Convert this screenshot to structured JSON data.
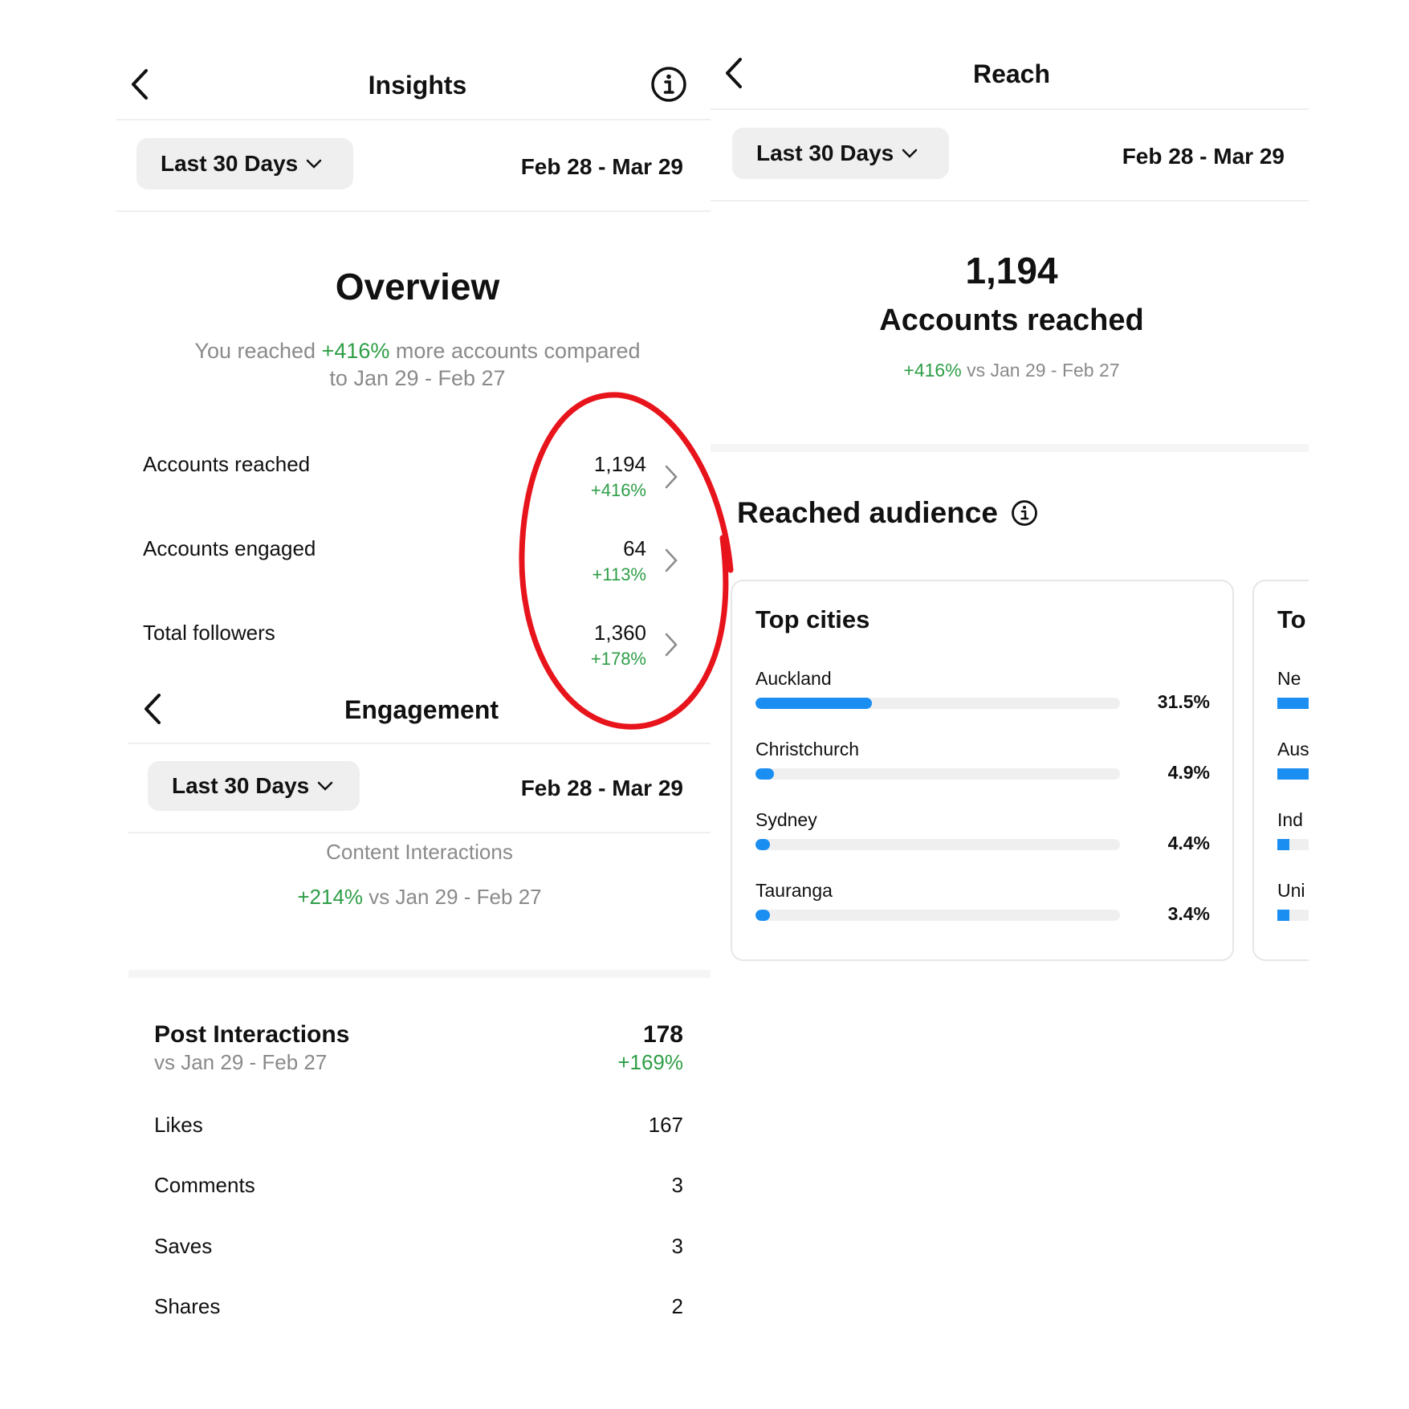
{
  "insights": {
    "title": "Insights",
    "range_label": "Last 30 Days",
    "date_range": "Feb 28 - Mar 29",
    "overview_title": "Overview",
    "summary_prefix": "You reached",
    "summary_delta": "+416%",
    "summary_suffix": "more accounts compared",
    "summary_line2": "to Jan 29 - Feb 27",
    "rows": [
      {
        "label": "Accounts reached",
        "value": "1,194",
        "delta": "+416%"
      },
      {
        "label": "Accounts engaged",
        "value": "64",
        "delta": "+113%"
      },
      {
        "label": "Total followers",
        "value": "1,360",
        "delta": "+178%"
      }
    ]
  },
  "engagement": {
    "title": "Engagement",
    "range_label": "Last 30 Days",
    "date_range": "Feb 28 - Mar 29",
    "content_label": "Content Interactions",
    "content_delta": "+214%",
    "content_compare": "vs Jan 29 - Feb 27",
    "post_title": "Post Interactions",
    "post_compare": "vs Jan 29 - Feb 27",
    "post_value": "178",
    "post_delta": "+169%",
    "items": [
      {
        "label": "Likes",
        "value": "167"
      },
      {
        "label": "Comments",
        "value": "3"
      },
      {
        "label": "Saves",
        "value": "3"
      },
      {
        "label": "Shares",
        "value": "2"
      }
    ]
  },
  "reach": {
    "title": "Reach",
    "range_label": "Last 30 Days",
    "date_range": "Feb 28 - Mar 29",
    "big_number": "1,194",
    "big_label": "Accounts reached",
    "delta": "+416%",
    "compare": "vs Jan 29 - Feb 27",
    "audience_title": "Reached audience",
    "cities_title": "Top cities",
    "cities": [
      {
        "name": "Auckland",
        "pct": "31.5%",
        "fill": 0.32
      },
      {
        "name": "Christchurch",
        "pct": "4.9%",
        "fill": 0.05
      },
      {
        "name": "Sydney",
        "pct": "4.4%",
        "fill": 0.04
      },
      {
        "name": "Tauranga",
        "pct": "3.4%",
        "fill": 0.03
      }
    ],
    "clipped_card_title": "To",
    "clipped_items": [
      {
        "name": "Ne",
        "fill": 1.0
      },
      {
        "name": "Aus",
        "fill": 1.0
      },
      {
        "name": "Ind",
        "fill": 0.25
      },
      {
        "name": "Uni",
        "fill": 0.25
      }
    ]
  },
  "colors": {
    "green": "#2e9e47",
    "bar_blue": "#1b8ef2",
    "annotation_red": "#e8141c"
  }
}
